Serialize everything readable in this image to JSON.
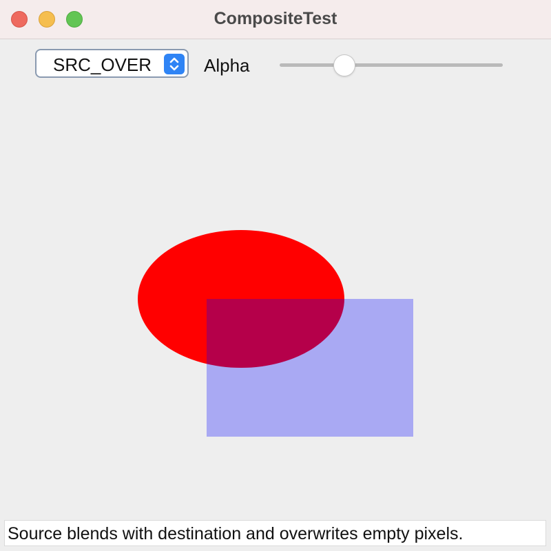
{
  "window": {
    "title": "CompositeTest"
  },
  "toolbar": {
    "composite_mode": {
      "selected": "SRC_OVER"
    },
    "alpha": {
      "label": "Alpha",
      "value_fraction": 0.29
    }
  },
  "canvas": {
    "shapes": [
      {
        "kind": "ellipse",
        "color": "#ff0000"
      },
      {
        "kind": "rectangle",
        "color": "#0000ff",
        "opacity": 0.29
      }
    ],
    "overlap_color": "#b60048"
  },
  "status": {
    "text": "Source blends with destination and overwrites empty pixels."
  },
  "colors": {
    "titlebar": "#f5ecec",
    "window_bg": "#eeeeee",
    "accent": "#2f84f5",
    "close": "#ee6a5f",
    "minimize": "#f5be4f",
    "maximize": "#62c554",
    "ellipse": "#ff0000",
    "rectangle_blend": "#aaaaf5"
  }
}
